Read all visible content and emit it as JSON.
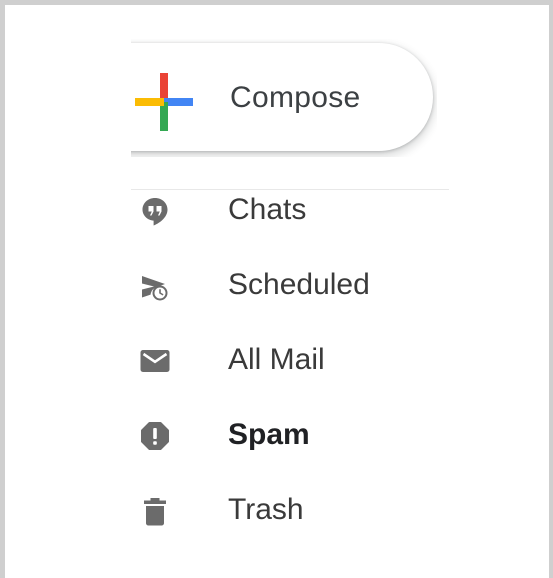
{
  "compose": {
    "label": "Compose"
  },
  "nav": {
    "items": [
      {
        "label": "Chats",
        "icon": "chat-bubble-icon",
        "bold": false
      },
      {
        "label": "Scheduled",
        "icon": "scheduled-send-icon",
        "bold": false
      },
      {
        "label": "All Mail",
        "icon": "envelope-icon",
        "bold": false
      },
      {
        "label": "Spam",
        "icon": "report-spam-icon",
        "bold": true
      },
      {
        "label": "Trash",
        "icon": "trash-icon",
        "bold": false
      }
    ]
  },
  "colors": {
    "plus_red": "#ea4335",
    "plus_blue": "#4285f4",
    "plus_green": "#34a853",
    "plus_yellow": "#fbbc04",
    "icon_gray": "#6b6b6b",
    "frame_border": "#cfcfcf"
  }
}
